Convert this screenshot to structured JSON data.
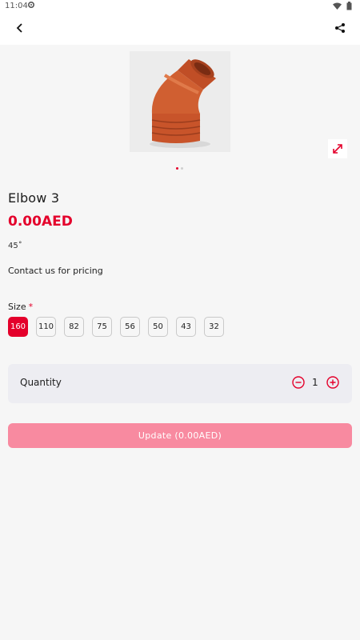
{
  "status_bar": {
    "time": "11:04"
  },
  "colors": {
    "accent": "#e4002b",
    "button_disabled": "#f88aa0",
    "quantity_bg": "#ededf2",
    "background": "#f6f6f6"
  },
  "icons": {
    "back": "back-arrow-icon",
    "share": "share-icon",
    "expand": "expand-icon",
    "minus": "minus-circle-icon",
    "plus": "plus-circle-icon",
    "settings": "gear-icon",
    "wifi": "wifi-icon",
    "battery": "battery-icon"
  },
  "product": {
    "title": "Elbow 3",
    "price": "0.00AED",
    "angle": "45˚",
    "contact_note": "Contact us for pricing",
    "image_count": 2,
    "active_image_index": 0
  },
  "size": {
    "label": "Size",
    "required_mark": "*",
    "options": [
      "160",
      "110",
      "82",
      "75",
      "56",
      "50",
      "43",
      "32"
    ],
    "selected": "160"
  },
  "quantity": {
    "label": "Quantity",
    "value": "1"
  },
  "update_button": {
    "label": "Update (0.00AED)"
  }
}
